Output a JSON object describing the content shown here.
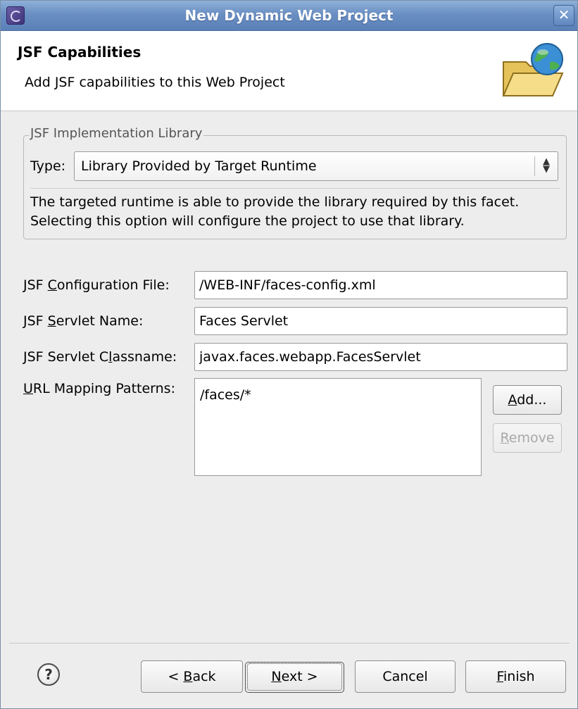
{
  "window": {
    "title": "New Dynamic Web Project",
    "close_symbol": "✕"
  },
  "banner": {
    "heading": "JSF Capabilities",
    "description": "Add JSF capabilities to this Web Project",
    "icon": "folder-globe-icon"
  },
  "library_group": {
    "legend": "JSF Implementation Library",
    "type_label": "Type:",
    "type_value": "Library Provided by Target Runtime",
    "info_line1": "The targeted runtime is able to provide the library required by this facet.",
    "info_line2": "Selecting this option will configure the project to use that library."
  },
  "form": {
    "config_file": {
      "label_prefix": "JSF ",
      "label_mnemonic": "C",
      "label_suffix": "onfiguration File:",
      "value": "/WEB-INF/faces-config.xml"
    },
    "servlet_name": {
      "label_prefix": "JSF ",
      "label_mnemonic": "S",
      "label_suffix": "ervlet Name:",
      "value": "Faces Servlet"
    },
    "servlet_classname": {
      "label_prefix": "JSF Servlet C",
      "label_mnemonic": "l",
      "label_suffix": "assname:",
      "value": "javax.faces.webapp.FacesServlet"
    },
    "url_mapping": {
      "label_mnemonic": "U",
      "label_suffix": "RL Mapping Patterns:",
      "items": [
        "/faces/*"
      ]
    },
    "add_button": {
      "mnemonic": "A",
      "rest": "dd..."
    },
    "remove_button": {
      "mnemonic": "R",
      "rest": "emove",
      "enabled": false
    }
  },
  "footer": {
    "help_symbol": "?",
    "back_button": {
      "prefix": "< ",
      "mnemonic": "B",
      "rest": "ack"
    },
    "next_button": {
      "mnemonic": "N",
      "rest": "ext >"
    },
    "cancel_button": "Cancel",
    "finish_button": {
      "mnemonic": "F",
      "rest": "inish"
    }
  }
}
